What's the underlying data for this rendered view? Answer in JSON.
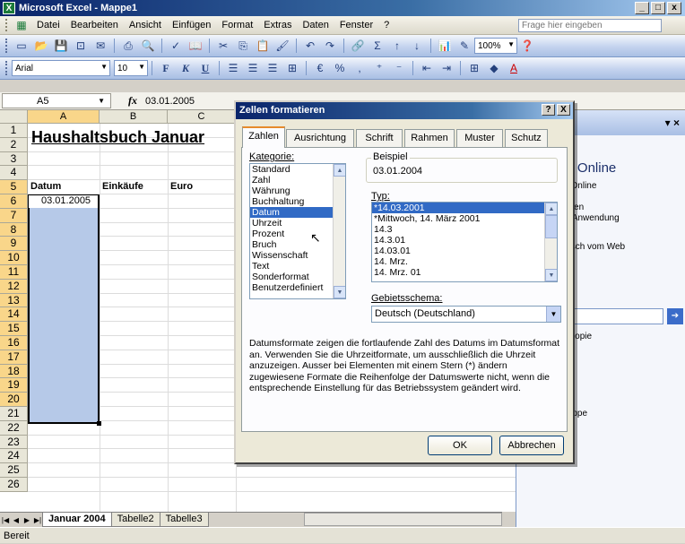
{
  "window": {
    "title": "Microsoft Excel - Mappe1",
    "icon_letter": "X",
    "min": "_",
    "max": "□",
    "close": "x"
  },
  "menu": {
    "items": [
      "Datei",
      "Bearbeiten",
      "Ansicht",
      "Einfügen",
      "Format",
      "Extras",
      "Daten",
      "Fenster",
      "?"
    ],
    "help_placeholder": "Frage hier eingeben"
  },
  "toolbar": {
    "font_name": "Arial",
    "font_size": "10",
    "zoom": "100%",
    "bold": "F",
    "italic": "K",
    "underline": "U"
  },
  "formula_bar": {
    "name_box": "A5",
    "fx": "fx",
    "value": "03.01.2005"
  },
  "sheet": {
    "columns": [
      "A",
      "B",
      "C"
    ],
    "rows": [
      "1",
      "2",
      "3",
      "4",
      "5",
      "6",
      "7",
      "8",
      "9",
      "10",
      "11",
      "12",
      "13",
      "14",
      "15",
      "16",
      "17",
      "18",
      "19",
      "20",
      "21",
      "22",
      "23",
      "24",
      "25",
      "26"
    ],
    "title": "Haushaltsbuch Januar",
    "headers": [
      "Datum",
      "Einkäufe",
      "Euro"
    ],
    "a5": "03.01.2005",
    "tabs": [
      "Januar 2004",
      "Tabelle2",
      "Tabelle3"
    ],
    "status": "Bereit"
  },
  "taskpane": {
    "title_fragment": "tte",
    "heading": "oft Office Online",
    "lines": [
      "rosoft Office Online",
      "len",
      "n Sie die letzten",
      "gen über die Anwendung",
      "cel",
      "iste automatisch vom Web",
      "ieren",
      "e...",
      "h:",
      "ehr als eine Kopie",
      "ucken\"",
      "...",
      "ue Arbeitsmappe",
      "n..."
    ]
  },
  "dialog": {
    "title": "Zellen formatieren",
    "help": "?",
    "close": "X",
    "tabs": [
      "Zahlen",
      "Ausrichtung",
      "Schrift",
      "Rahmen",
      "Muster",
      "Schutz"
    ],
    "category_label": "Kategorie:",
    "categories": [
      "Standard",
      "Zahl",
      "Währung",
      "Buchhaltung",
      "Datum",
      "Uhrzeit",
      "Prozent",
      "Bruch",
      "Wissenschaft",
      "Text",
      "Sonderformat",
      "Benutzerdefiniert"
    ],
    "selected_category": "Datum",
    "sample_label": "Beispiel",
    "sample_value": "03.01.2004",
    "type_label": "Typ:",
    "types": [
      "*14.03.2001",
      "*Mittwoch, 14. März 2001",
      "14.3",
      "14.3.01",
      "14.03.01",
      "14. Mrz.",
      "14. Mrz. 01"
    ],
    "locale_label": "Gebietsschema:",
    "locale_value": "Deutsch (Deutschland)",
    "description": "Datumsformate zeigen die fortlaufende Zahl des Datums im Datumsformat an. Verwenden Sie die Uhrzeitformate, um ausschließlich die Uhrzeit anzuzeigen. Ausser bei Elementen mit einem Stern (*) ändern zugewiesene Formate die Reihenfolge der Datumswerte nicht, wenn die entsprechende Einstellung für das Betriebssystem geändert wird.",
    "ok": "OK",
    "cancel": "Abbrechen"
  }
}
